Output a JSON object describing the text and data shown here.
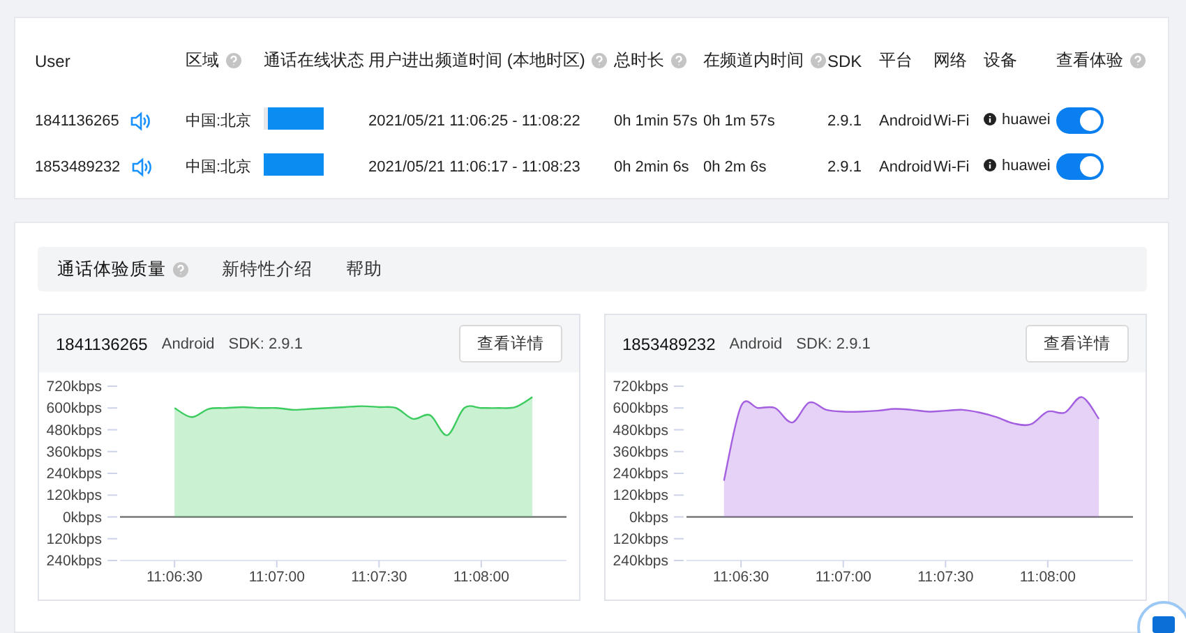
{
  "users_table": {
    "columns": [
      {
        "label": "User",
        "help": false
      },
      {
        "label": "区域",
        "help": true
      },
      {
        "label": "通话在线状态",
        "help": false
      },
      {
        "label": "用户进出频道时间 (本地时区)",
        "help": true
      },
      {
        "label": "总时长",
        "help": true
      },
      {
        "label": "在频道内时间",
        "help": true
      },
      {
        "label": "SDK",
        "help": false
      },
      {
        "label": "平台",
        "help": false
      },
      {
        "label": "网络",
        "help": false
      },
      {
        "label": "设备",
        "help": false
      },
      {
        "label": "查看体验",
        "help": true
      }
    ],
    "rows": [
      {
        "user": "1841136265",
        "region": "中国:北京",
        "time_range": "2021/05/21 11:06:25 - 11:08:22",
        "total_duration": "0h 1min 57s",
        "in_channel_time": "0h 1m 57s",
        "sdk": "2.9.1",
        "platform": "Android",
        "network": "Wi-Fi",
        "device": "huawei",
        "view_experience_on": true
      },
      {
        "user": "1853489232",
        "region": "中国:北京",
        "time_range": "2021/05/21 11:06:17 - 11:08:23",
        "total_duration": "0h 2min 6s",
        "in_channel_time": "0h 2m 6s",
        "sdk": "2.9.1",
        "platform": "Android",
        "network": "Wi-Fi",
        "device": "huawei",
        "view_experience_on": true
      }
    ]
  },
  "quality_tabs": [
    {
      "label": "通话体验质量",
      "help": true,
      "selected": true
    },
    {
      "label": "新特性介绍",
      "help": false,
      "selected": false
    },
    {
      "label": "帮助",
      "help": false,
      "selected": false
    }
  ],
  "user_charts": [
    {
      "user": "1841136265",
      "platform": "Android",
      "sdk": "SDK: 2.9.1",
      "details_button": "查看详情",
      "chart_data": {
        "type": "area",
        "categories": [
          null,
          null,
          null,
          "11:06:30",
          null,
          null,
          null,
          null,
          null,
          "11:07:00",
          null,
          null,
          null,
          null,
          null,
          "11:07:30",
          null,
          null,
          null,
          null,
          null,
          "11:08:00",
          null,
          null,
          null,
          null,
          null
        ],
        "series": [
          {
            "color": "#3ccb5e",
            "values": [
              null,
              null,
              null,
              600,
              550,
              595,
              600,
              605,
              600,
              600,
              590,
              595,
              600,
              605,
              610,
              605,
              600,
              540,
              560,
              450,
              600,
              600,
              600,
              605,
              660,
              null,
              null
            ]
          }
        ],
        "ylim": [
          -240,
          720
        ],
        "yticks": [
          {
            "value": 720,
            "label": "720kbps"
          },
          {
            "value": 600,
            "label": "600kbps"
          },
          {
            "value": 480,
            "label": "480kbps"
          },
          {
            "value": 360,
            "label": "360kbps"
          },
          {
            "value": 240,
            "label": "240kbps"
          },
          {
            "value": 120,
            "label": "120kbps"
          },
          {
            "value": 0,
            "label": "0kbps"
          },
          {
            "value": -120,
            "label": "120kbps"
          },
          {
            "value": -240,
            "label": "240kbps"
          }
        ]
      }
    },
    {
      "user": "1853489232",
      "platform": "Android",
      "sdk": "SDK: 2.9.1",
      "details_button": "查看详情",
      "chart_data": {
        "type": "area",
        "categories": [
          null,
          null,
          null,
          "11:06:30",
          null,
          null,
          null,
          null,
          null,
          "11:07:00",
          null,
          null,
          null,
          null,
          null,
          "11:07:30",
          null,
          null,
          null,
          null,
          null,
          "11:08:00",
          null,
          null,
          null,
          null,
          null
        ],
        "series": [
          {
            "color": "#a35fe0",
            "values": [
              null,
              null,
              200,
              610,
              600,
              600,
              520,
              630,
              590,
              580,
              580,
              585,
              595,
              590,
              580,
              585,
              590,
              575,
              550,
              515,
              510,
              580,
              575,
              660,
              540,
              null,
              null
            ]
          }
        ],
        "ylim": [
          -240,
          720
        ],
        "yticks": [
          {
            "value": 720,
            "label": "720kbps"
          },
          {
            "value": 600,
            "label": "600kbps"
          },
          {
            "value": 480,
            "label": "480kbps"
          },
          {
            "value": 360,
            "label": "360kbps"
          },
          {
            "value": 240,
            "label": "240kbps"
          },
          {
            "value": 120,
            "label": "120kbps"
          },
          {
            "value": 0,
            "label": "0kbps"
          },
          {
            "value": -120,
            "label": "120kbps"
          },
          {
            "value": -240,
            "label": "240kbps"
          }
        ]
      }
    }
  ]
}
